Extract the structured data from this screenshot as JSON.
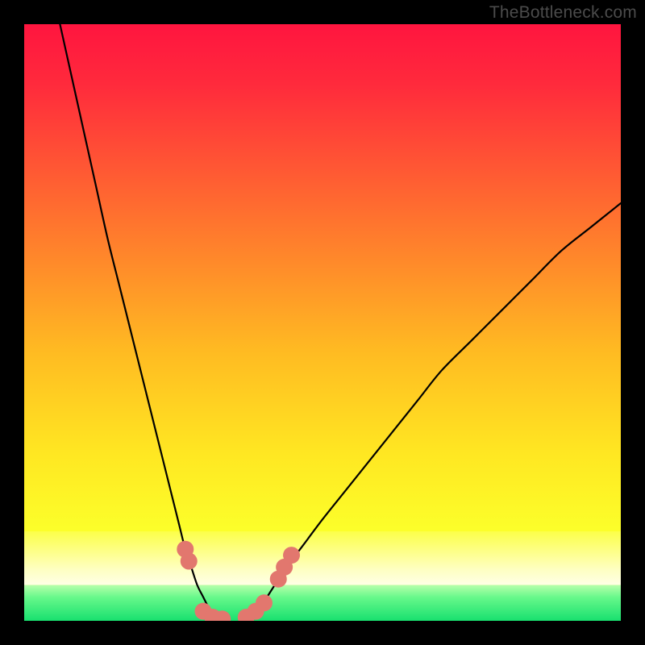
{
  "watermark": "TheBottleneck.com",
  "chart_data": {
    "type": "line",
    "title": "",
    "xlabel": "",
    "ylabel": "",
    "xlim": [
      0,
      100
    ],
    "ylim": [
      0,
      100
    ],
    "grid": false,
    "series": [
      {
        "name": "left-curve",
        "x": [
          6,
          8,
          10,
          12,
          14,
          16,
          18,
          20,
          22,
          24,
          25,
          26,
          27,
          28,
          29,
          30,
          31,
          32
        ],
        "y": [
          100,
          91,
          82,
          73,
          64,
          56,
          48,
          40,
          32,
          24,
          20,
          16,
          12,
          9,
          6,
          4,
          2,
          0
        ]
      },
      {
        "name": "right-curve",
        "x": [
          37,
          38,
          40,
          42,
          44,
          47,
          50,
          54,
          58,
          62,
          66,
          70,
          75,
          80,
          85,
          90,
          95,
          100
        ],
        "y": [
          0,
          1,
          3,
          6,
          9,
          13,
          17,
          22,
          27,
          32,
          37,
          42,
          47,
          52,
          57,
          62,
          66,
          70
        ]
      }
    ],
    "markers": [
      {
        "name": "left-dot-1",
        "x": 27.0,
        "y": 12.0
      },
      {
        "name": "left-dot-2",
        "x": 27.6,
        "y": 10.0
      },
      {
        "name": "bottom-dot-1",
        "x": 30.0,
        "y": 1.6
      },
      {
        "name": "bottom-dot-2",
        "x": 31.6,
        "y": 0.6
      },
      {
        "name": "bottom-dot-3",
        "x": 33.2,
        "y": 0.3
      },
      {
        "name": "bottom-dot-4",
        "x": 37.2,
        "y": 0.6
      },
      {
        "name": "bottom-dot-5",
        "x": 38.8,
        "y": 1.6
      },
      {
        "name": "bottom-dot-6",
        "x": 40.2,
        "y": 3.0
      },
      {
        "name": "right-dot-1",
        "x": 42.6,
        "y": 7.0
      },
      {
        "name": "right-dot-2",
        "x": 43.6,
        "y": 9.0
      },
      {
        "name": "right-dot-3",
        "x": 44.8,
        "y": 11.0
      }
    ],
    "green_band": {
      "y_start": 0,
      "y_end": 6
    },
    "yellow_band": {
      "y_start": 6,
      "y_end": 15
    }
  }
}
